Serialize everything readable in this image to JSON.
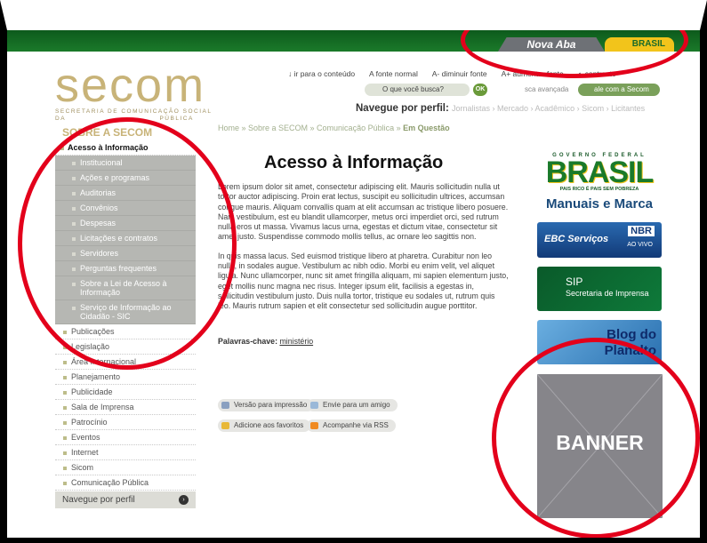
{
  "colors": {
    "accent_green": "#1b7a2a",
    "logo_gold": "#c8b378",
    "sidebar_sub_bg": "#b6b7b3",
    "annotation_red": "#e3001b",
    "banner_gray": "#86858a"
  },
  "header": {
    "tab_nova_aba": "Nova Aba",
    "tab_brasil": "BRASIL",
    "logo": {
      "word": "secom",
      "sub1": "SECRETARIA DE COMUNICAÇÃO SOCIAL",
      "sub2": "DA                                PÚBLICA"
    },
    "utility": [
      "↓ ir para o conteúdo",
      "A fonte normal",
      "A- diminuir fonte",
      "A+ aumentar fonte",
      "◐ contraste"
    ],
    "search_placeholder": "O que você busca?",
    "ok_label": "OK",
    "advanced_search": "sca avançada",
    "fale_label": "ale com a Secom",
    "perfil_label": "Navegue por perfil:",
    "perfil_links": "Jornalistas  ›  Mercado  ›  Acadêmico  ›  Sicom  ›  Licitantes"
  },
  "breadcrumb": {
    "path": "Home » Sobre a SECOM » Comunicação Pública » ",
    "current": "Em Questão"
  },
  "sidebar": {
    "title": "SOBRE A SECOM",
    "active": "Acesso à Informação",
    "sub_items": [
      "Institucional",
      "Ações e programas",
      "Auditorias",
      "Convênios",
      "Despesas",
      "Licitações e contratos",
      "Servidores",
      "Perguntas frequentes",
      "Sobre a Lei de Acesso à Informação",
      "Serviço de Informação ao Cidadão - SIC"
    ],
    "items": [
      "Publicações",
      "Legislação",
      "Área Internacional",
      "Planejamento",
      "Publicidade",
      "Sala de Imprensa",
      "Patrocínio",
      "Eventos",
      "Internet",
      "Sicom",
      "Comunicação Pública"
    ],
    "perfil_bottom": "Navegue por perfil",
    "perfil_arrow": "›"
  },
  "main": {
    "title": "Acesso à Informação",
    "para1": "Lorem ipsum dolor sit amet, consectetur adipiscing elit. Mauris sollicitudin nulla ut tortor auctor adipiscing. Proin erat lectus, suscipit eu sollicitudin ultrices, accumsan congue mauris. Aliquam convallis quam at elit accumsan ac tristique libero posuere. Nam vestibulum, est eu blandit ullamcorper, metus orci imperdiet orci, sed rutrum nulla eros ut massa. Vivamus lacus urna, egestas et dictum vitae, consectetur sit amet justo. Suspendisse commodo mollis tellus, ac ornare leo sagittis non.",
    "para2": "In quis massa lacus. Sed euismod tristique libero at pharetra. Curabitur non leo nulla, in sodales augue. Vestibulum ac nibh odio. Morbi eu enim velit, vel aliquet ligula. Nunc ullamcorper, nunc sit amet fringilla aliquam, mi sapien elementum justo, eget mollis nunc magna nec risus. Integer ipsum elit, facilisis a egestas in, sollicitudin vestibulum justo. Duis nulla tortor, tristique eu sodales ut, rutrum quis leo. Mauris rutrum sapien et elit consectetur sed sollicitudin augue porttitor.",
    "keywords_label": "Palavras-chave:",
    "keywords_value": "ministério",
    "tools": [
      "Versão para impressão",
      "Envie para um amigo",
      "Adicione aos favoritos",
      "Acompanhe via RSS"
    ]
  },
  "right": {
    "gov_label": "GOVERNO FEDERAL",
    "brasil_logo": "BRASIL",
    "brasil_tagline": "PAIS RICO É PAIS SEM POBREZA",
    "manuais": "Manuais e Marca",
    "ebc": {
      "left": "EBC Serviços",
      "right": "NBR",
      "sub": "AO VIVO"
    },
    "sip": {
      "title": "SIP",
      "sub": "Secretaria de Imprensa"
    },
    "blog": {
      "line1": "Blog do",
      "line2": "Planalto"
    },
    "banner": "BANNER"
  }
}
